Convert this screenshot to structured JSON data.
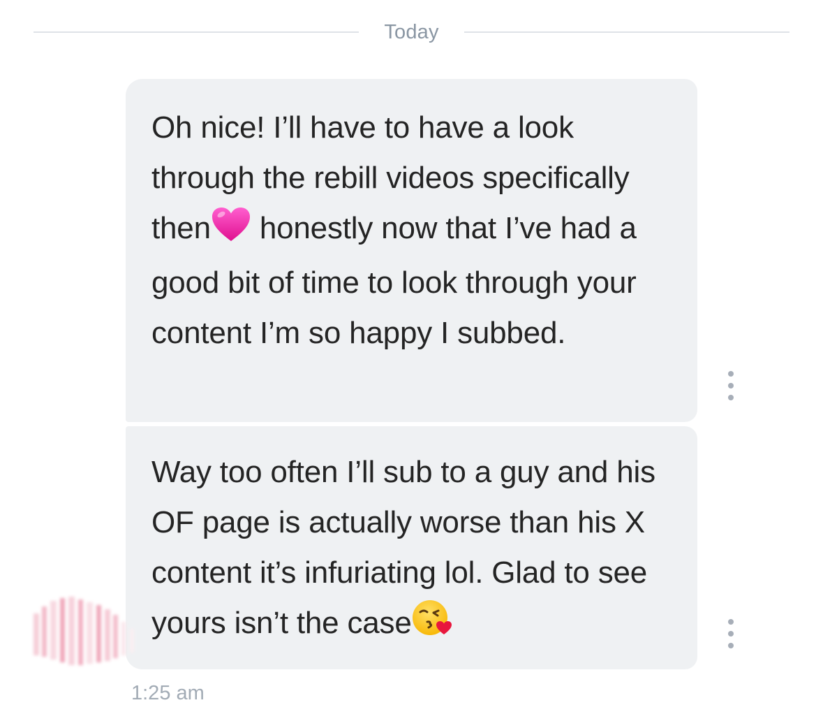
{
  "divider": {
    "label": "Today"
  },
  "messages": [
    {
      "segments": [
        "Oh nice! I’ll have to have a look through the rebill videos specifically then",
        "honestly now that I’ve had a good bit of time to look through your content I’m so happy I subbed."
      ],
      "emoji_icon": "pink-heart-icon"
    },
    {
      "segments": [
        "Way too often I’ll sub to a guy and his OF page is actually worse than his X content it’s infuriating lol. Glad to see yours isn’t the case"
      ],
      "emoji_icon": "face-blowing-kiss-icon"
    }
  ],
  "timestamp": "1:25 am",
  "colors": {
    "bubble": "#eff1f3",
    "text": "#242424",
    "muted": "#8a96a3",
    "divider_line": "#dfe2e7",
    "menu_dots": "#a7aeb8"
  }
}
